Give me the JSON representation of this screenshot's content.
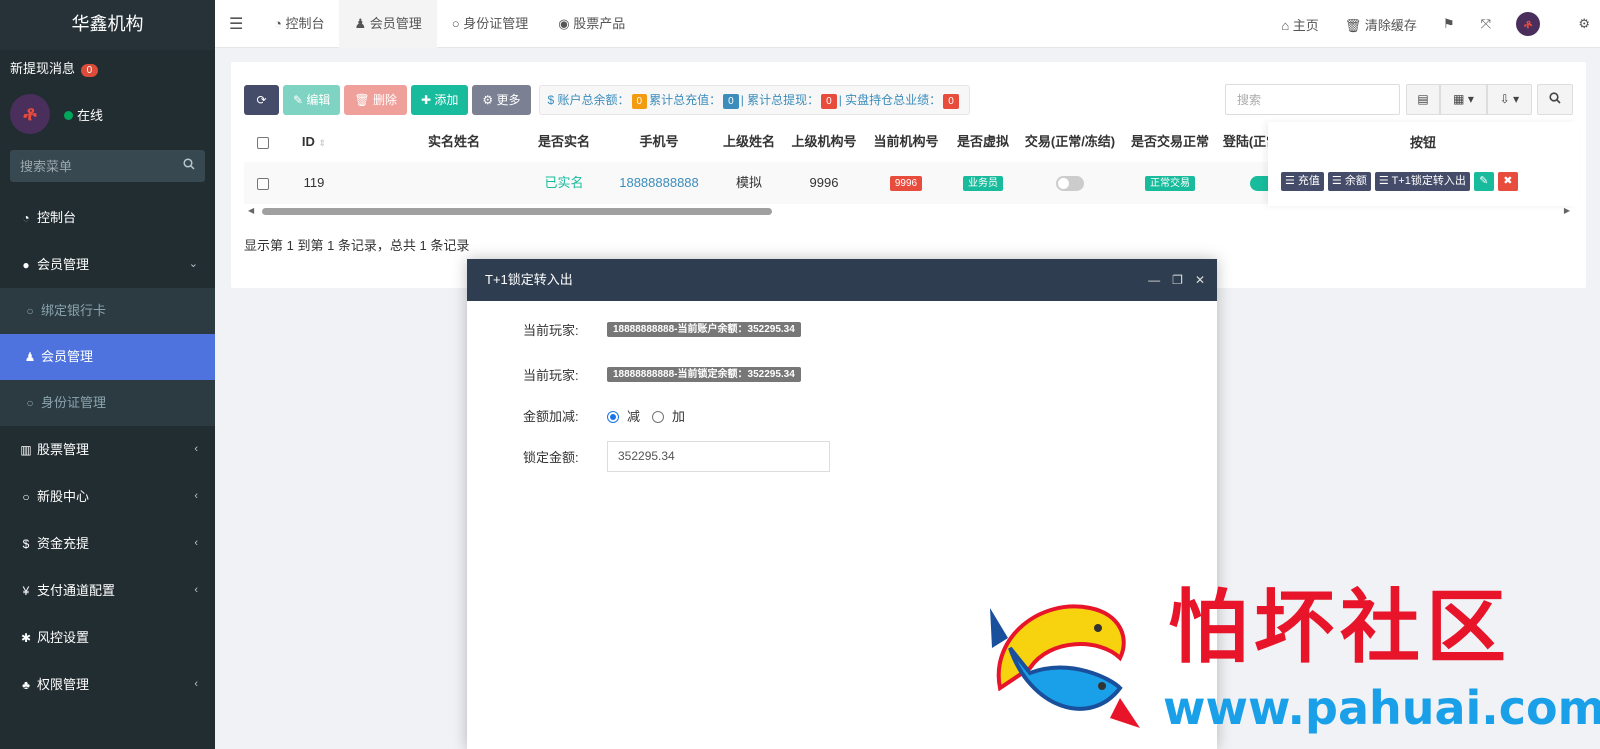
{
  "sidebar": {
    "brand": "华鑫机构",
    "notice_label": "新提现消息",
    "notice_count": "0",
    "status": "在线",
    "search_placeholder": "搜索菜单",
    "menu": {
      "dashboard": "控制台",
      "members": "会员管理",
      "sub_bankcard": "绑定银行卡",
      "sub_members": "会员管理",
      "sub_idcard": "身份证管理",
      "stocks": "股票管理",
      "ipo": "新股中心",
      "funds": "资金充提",
      "payment": "支付通道配置",
      "risk": "风控设置",
      "permissions": "权限管理"
    }
  },
  "topbar": {
    "tabs": [
      "控制台",
      "会员管理",
      "身份证管理",
      "股票产品"
    ],
    "home": "主页",
    "clear_cache": "清除缓存"
  },
  "toolbar": {
    "edit": "编辑",
    "delete": "删除",
    "add": "添加",
    "more": "更多",
    "stat_balance_label": "账户总余额：",
    "stat_balance": "0",
    "stat_recharge_label": "累计总充值：",
    "stat_recharge": "0",
    "stat_withdraw_label": "累计总提现：",
    "stat_withdraw": "0",
    "stat_perf_label": "实盘持仓总业绩：",
    "stat_perf": "0",
    "search_placeholder": "搜索"
  },
  "table": {
    "headers": {
      "id": "ID",
      "real_name": "实名姓名",
      "verified": "是否实名",
      "phone": "手机号",
      "parent_name": "上级姓名",
      "parent_org": "上级机构号",
      "current_org": "当前机构号",
      "virtual": "是否虚拟",
      "trade": "交易(正常/冻结)",
      "trade_ok": "是否交易正常",
      "login": "登陆(正常",
      "actions": "按钮"
    },
    "row": {
      "id": "119",
      "real_name": "",
      "verified": "已实名",
      "phone": "18888888888",
      "parent_name": "模拟",
      "parent_org": "9996",
      "current_org": "9996",
      "virtual": "业务员",
      "trade_ok": "正常交易"
    },
    "actions": {
      "recharge": "充值",
      "balance": "余额",
      "t1": "T+1锁定转入出"
    },
    "records": "显示第 1 到第 1 条记录，总共 1 条记录"
  },
  "modal": {
    "title": "T+1锁定转入出",
    "player_label_1": "当前玩家:",
    "player_value_1": "18888888888-当前账户余额：352295.34",
    "player_label_2": "当前玩家:",
    "player_value_2": "18888888888-当前锁定余额：352295.34",
    "adjust_label": "金额加减:",
    "opt_minus": "减",
    "opt_plus": "加",
    "amount_label": "锁定金额:",
    "amount_value": "352295.34"
  },
  "watermark": {
    "title": "怕坏社区",
    "url": "www.pahuai.com"
  }
}
